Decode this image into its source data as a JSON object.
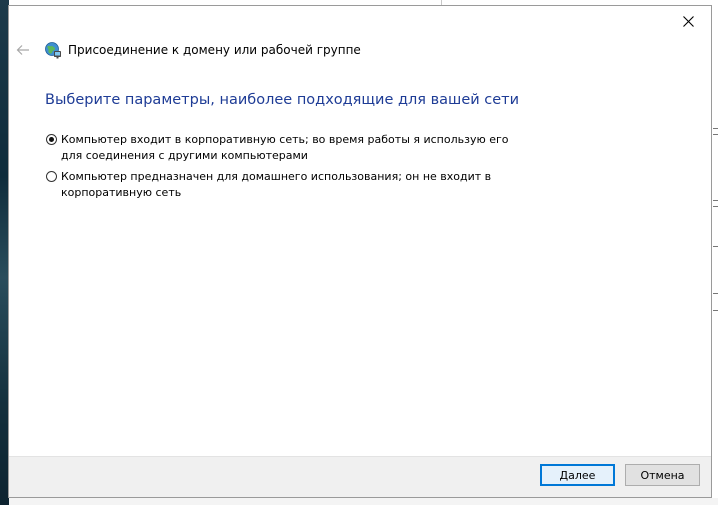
{
  "dialog": {
    "title": "Присоединение к домену или рабочей группе",
    "heading": "Выберите параметры, наиболее подходящие для вашей сети",
    "options": [
      {
        "label": "Компьютер входит в корпоративную сеть; во время работы я использую его для соединения с другими компьютерами",
        "checked": true
      },
      {
        "label": "Компьютер предназначен для домашнего использования; он не входит в корпоративную сеть",
        "checked": false
      }
    ],
    "buttons": {
      "next": "Далее",
      "cancel": "Отмена"
    }
  },
  "icons": {
    "back": "back-arrow-icon",
    "wizard": "network-globe-icon",
    "close": "close-icon"
  },
  "colors": {
    "heading": "#1e3c96",
    "primary_border": "#0078d7"
  }
}
